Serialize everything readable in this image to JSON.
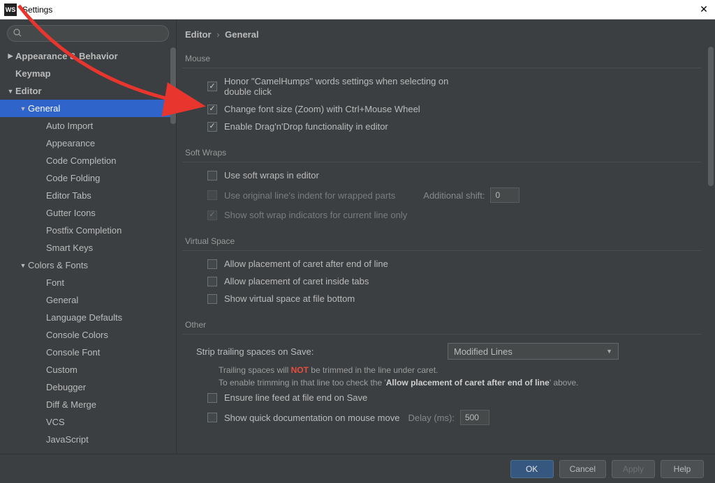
{
  "window": {
    "title": "Settings",
    "app_icon_text": "WS"
  },
  "search": {
    "placeholder": ""
  },
  "sidebar": {
    "items": [
      {
        "label": "Appearance & Behavior",
        "level": 0,
        "arrow": "right",
        "bold": true
      },
      {
        "label": "Keymap",
        "level": 0,
        "bold": true
      },
      {
        "label": "Editor",
        "level": 0,
        "arrow": "down",
        "bold": true
      },
      {
        "label": "General",
        "level": 1,
        "arrow": "down",
        "selected": true
      },
      {
        "label": "Auto Import",
        "level": 2
      },
      {
        "label": "Appearance",
        "level": 2
      },
      {
        "label": "Code Completion",
        "level": 2
      },
      {
        "label": "Code Folding",
        "level": 2
      },
      {
        "label": "Editor Tabs",
        "level": 2
      },
      {
        "label": "Gutter Icons",
        "level": 2
      },
      {
        "label": "Postfix Completion",
        "level": 2
      },
      {
        "label": "Smart Keys",
        "level": 2
      },
      {
        "label": "Colors & Fonts",
        "level": 1,
        "arrow": "down"
      },
      {
        "label": "Font",
        "level": 2
      },
      {
        "label": "General",
        "level": 2
      },
      {
        "label": "Language Defaults",
        "level": 2
      },
      {
        "label": "Console Colors",
        "level": 2
      },
      {
        "label": "Console Font",
        "level": 2
      },
      {
        "label": "Custom",
        "level": 2
      },
      {
        "label": "Debugger",
        "level": 2
      },
      {
        "label": "Diff & Merge",
        "level": 2
      },
      {
        "label": "VCS",
        "level": 2
      },
      {
        "label": "JavaScript",
        "level": 2
      }
    ]
  },
  "breadcrumb": {
    "a": "Editor",
    "b": "General"
  },
  "sections": {
    "mouse": {
      "title": "Mouse",
      "honor": {
        "label": "Honor \"CamelHumps\" words settings when selecting on double click",
        "checked": true
      },
      "zoom": {
        "label": "Change font size (Zoom) with Ctrl+Mouse Wheel",
        "checked": true
      },
      "dnd": {
        "label": "Enable Drag'n'Drop functionality in editor",
        "checked": true
      }
    },
    "softwraps": {
      "title": "Soft Wraps",
      "use": {
        "label": "Use soft wraps in editor",
        "checked": false
      },
      "indent": {
        "label": "Use original line's indent for wrapped parts",
        "checked": false,
        "disabled": true,
        "shift_label": "Additional shift:",
        "shift_value": "0"
      },
      "show": {
        "label": "Show soft wrap indicators for current line only",
        "checked": true,
        "disabled": true
      }
    },
    "virtual": {
      "title": "Virtual Space",
      "eol": {
        "label": "Allow placement of caret after end of line",
        "checked": false
      },
      "tabs": {
        "label": "Allow placement of caret inside tabs",
        "checked": false
      },
      "bottom": {
        "label": "Show virtual space at file bottom",
        "checked": false
      }
    },
    "other": {
      "title": "Other",
      "strip_label": "Strip trailing spaces on Save:",
      "strip_value": "Modified Lines",
      "note_pre": "Trailing spaces will ",
      "note_not": "NOT",
      "note_post": " be trimmed in the line under caret.",
      "note2_pre": "To enable trimming in that line too check the '",
      "note2_bold": "Allow placement of caret after end of line",
      "note2_post": "' above.",
      "ensure": {
        "label": "Ensure line feed at file end on Save",
        "checked": false
      },
      "quickdoc": {
        "label": "Show quick documentation on mouse move",
        "checked": false,
        "delay_label": "Delay (ms):",
        "delay_value": "500"
      }
    }
  },
  "footer": {
    "ok": "OK",
    "cancel": "Cancel",
    "apply": "Apply",
    "help": "Help"
  }
}
